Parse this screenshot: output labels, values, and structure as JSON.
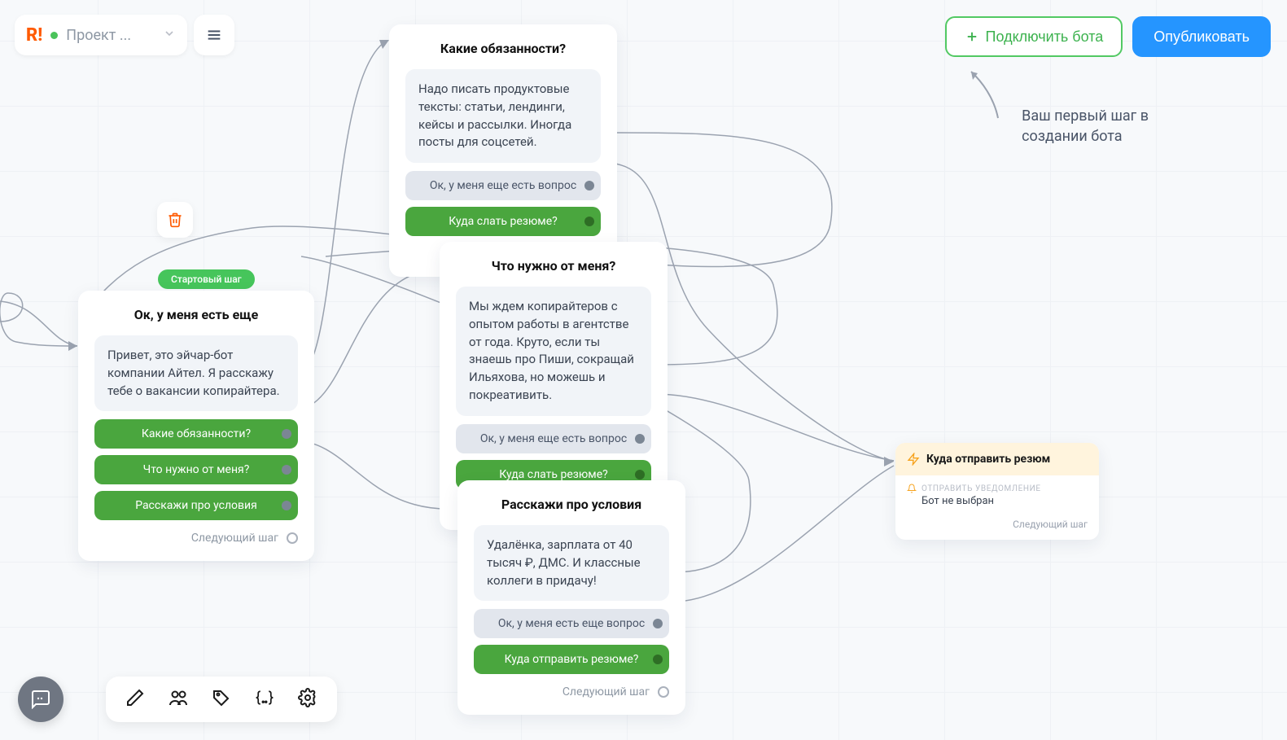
{
  "header": {
    "logo": "R!",
    "project_name": "Проект ...",
    "connect_label": "Подключить бота",
    "publish_label": "Опубликовать",
    "hint_line1": "Ваш первый шаг в",
    "hint_line2": "создании бота"
  },
  "start_badge": "Стартовый шаг",
  "next_step_label": "Следующий шаг",
  "cards": {
    "start": {
      "title": "Ок, у меня есть еще",
      "text": "Привет, это эйчар-бот компании Айтел. Я расскажу тебе о вакансии копирайтера.",
      "buttons": [
        "Какие обязанности?",
        "Что нужно от меня?",
        "Расскажи про условия"
      ]
    },
    "duties": {
      "title": "Какие обязанности?",
      "text": "Надо писать продуктовые тексты: статьи, лендинги, кейсы и рассылки. Иногда посты для соцсетей.",
      "b1": "Ок, у меня еще есть вопрос",
      "b2": "Куда слать резюме?"
    },
    "need": {
      "title": "Что нужно от меня?",
      "text": "Мы ждем копирайтеров с опытом работы в агентстве от года. Круто, если ты знаешь про Пиши, сокращай Ильяхова, но можешь и покреативить.",
      "b1": "Ок, у меня еще есть вопрос",
      "b2": "Куда слать резюме?"
    },
    "cond": {
      "title": "Расскажи про условия",
      "text": "Удалёнка, зарплата от 40 тысяч ₽, ДМС. И классные коллеги в придачу!",
      "b1": "Ок, у меня есть еще вопрос",
      "b2": "Куда отправить резюме?"
    }
  },
  "final": {
    "title": "Куда отправить резюм",
    "notif_label": "ОТПРАВИТЬ УВЕДОМЛЕНИЕ",
    "notif_value": "Бот не выбран"
  }
}
